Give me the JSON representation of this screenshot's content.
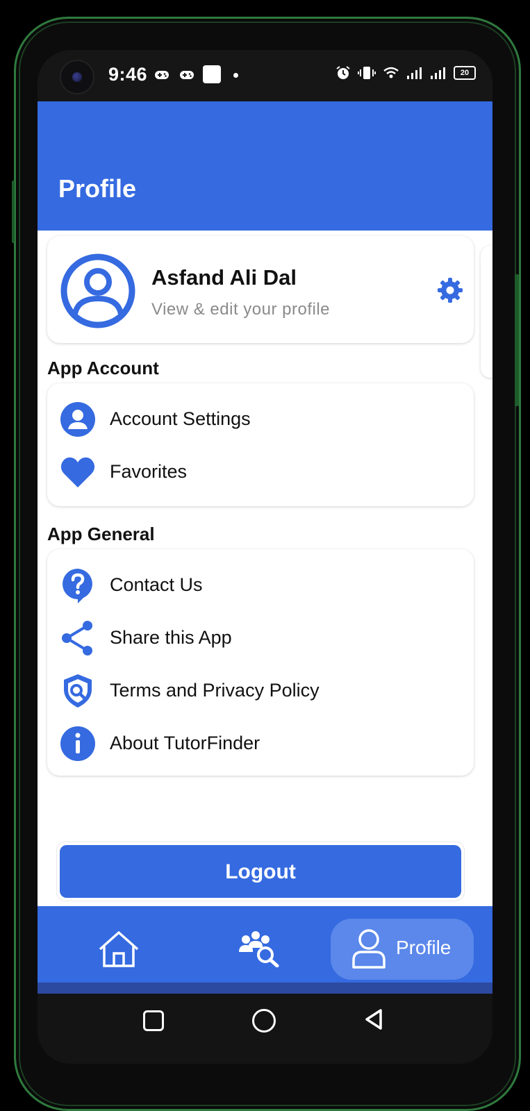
{
  "status_bar": {
    "time": "9:46",
    "battery": "20",
    "icons": [
      "gamepad-icon",
      "gamepad-icon",
      "square-notification-icon",
      "dot-icon",
      "alarm-icon",
      "vibrate-icon",
      "wifi-icon",
      "signal-icon",
      "signal-icon",
      "battery-icon"
    ]
  },
  "header": {
    "title": "Profile"
  },
  "profile": {
    "name": "Asfand Ali Dal",
    "subtitle": "View & edit your profile",
    "avatar_icon": "user-circle-icon",
    "settings_icon": "gear-icon"
  },
  "sections": {
    "account": {
      "title": "App Account",
      "items": [
        {
          "label": "Account Settings",
          "icon": "account-circle-icon"
        },
        {
          "label": "Favorites",
          "icon": "heart-icon"
        }
      ]
    },
    "general": {
      "title": "App General",
      "items": [
        {
          "label": "Contact Us",
          "icon": "help-bubble-icon"
        },
        {
          "label": "Share this App",
          "icon": "share-icon"
        },
        {
          "label": "Terms and Privacy Policy",
          "icon": "shield-search-icon"
        },
        {
          "label": "About TutorFinder",
          "icon": "info-icon"
        }
      ]
    }
  },
  "logout_label": "Logout",
  "bottom_nav": {
    "items": [
      {
        "icon": "home-icon"
      },
      {
        "icon": "find-tutors-icon"
      },
      {
        "icon": "profile-icon",
        "label": "Profile",
        "active": true
      }
    ]
  },
  "colors": {
    "primary": "#356ae0",
    "active_pill": "#5b88ea"
  }
}
